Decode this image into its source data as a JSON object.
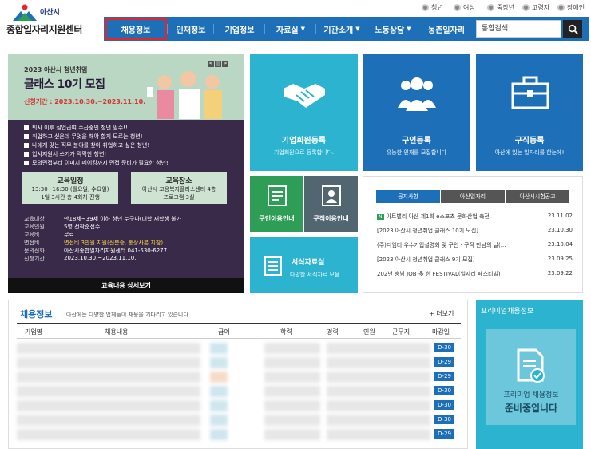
{
  "header": {
    "logo_small": "아산시",
    "logo_title": "종합일자리지원센터",
    "util_links": [
      "청년",
      "여성",
      "중장년",
      "고령자",
      "장애인"
    ]
  },
  "nav": {
    "items": [
      "채용정보",
      "인재정보",
      "기업정보",
      "자료실",
      "기관소개",
      "노동상담",
      "농촌일자리"
    ],
    "search_placeholder": "통합검색"
  },
  "banner": {
    "small": "2023 아산시 청년취업",
    "title": "클래스 10기 모집",
    "period": "신청기간 : 2023.10.30.~2023.11.10.",
    "bullets": [
      "퇴사 이후 실업급여 수급중인 청년 필수!!",
      "취업하고 싶은데 무엇을 해야 할지 모르는 청년!",
      "나에게 맞는 직무 분야를 찾아 취업하고 싶은 청년!",
      "입사지원서 쓰기가 막막한 청년!",
      "모의면접부터 이미지 메이킹까지 면접 준비가 필요한 청년!"
    ],
    "box1": {
      "head": "교육일정",
      "line1": "13:30~16:30 (월요일, 수요일)",
      "line2": "1일 3시간 총 4회차 진행"
    },
    "box2": {
      "head": "교육장소",
      "line1": "아산시 고용복지플러스센터 4층",
      "line2": "프로그램 3실"
    },
    "info": [
      {
        "k": "교육대상",
        "v": "만18세~39세 이하 청년 누구나(대학 재학생 불가"
      },
      {
        "k": "교육인원",
        "v": "5명 선착순접수"
      },
      {
        "k": "교육비",
        "v": "무료"
      },
      {
        "k": "면접비",
        "v": "면접비 3만원 지원(신분증, 통장사본 지참)"
      },
      {
        "k": "문의전화",
        "v": "아산시종합일자리지원센터 041-530-6277"
      },
      {
        "k": "신청기간",
        "v": "2023.10.30.~2023.11.10."
      }
    ],
    "detail_button": "교육내용 상세보기",
    "controls": [
      "<",
      "||",
      ">"
    ]
  },
  "tiles": {
    "member": {
      "title": "기업회원등록",
      "desc": "기업회원으로 등록합니다."
    },
    "talent": {
      "title": "구인등록",
      "desc": "유능한 인재를 모집합니다"
    },
    "jobseek": {
      "title": "구직등록",
      "desc": "아산에 있는 일자리를 한눈에!"
    },
    "guide_hire": {
      "title": "구인이용안내"
    },
    "guide_seek": {
      "title": "구직이용안내"
    },
    "library": {
      "title": "서식자료실",
      "desc": "다양한 서식자료 모음"
    }
  },
  "notice": {
    "tabs": [
      "공지사항",
      "아산일자리",
      "아산시시험공고"
    ],
    "rows": [
      {
        "title": "아트밸리 아산 제1회 e스포츠 문화산업 축전",
        "date": "23.11.02",
        "new": true
      },
      {
        "title": "[2023 아산시 청년취업 클래스 10기 모집]",
        "date": "23.10.30"
      },
      {
        "title": "(주)디엠티 우수기업설명회 및 구인 · 구직 만남의 날(...",
        "date": "23.10.04"
      },
      {
        "title": "[2023 아산시 청년취업 클래스 9기 모집]",
        "date": "23.09.25"
      },
      {
        "title": "202년 충남 JOB 多 한 FESTIVAL(일자리 페스티벌)",
        "date": "23.09.22"
      }
    ],
    "new_badge": "N"
  },
  "jobs": {
    "title": "채용정보",
    "desc": "아산에는 다양한 업체들이 채용을 기다리고 있습니다.",
    "more": "+ 더보기",
    "columns": [
      "기업명",
      "채용내용",
      "급여",
      "학력",
      "경력",
      "인원",
      "근무지",
      "마감일"
    ],
    "deadlines": [
      "D-30",
      "D-29",
      "D-29",
      "D-30",
      "D-30",
      "D-30",
      "D-29"
    ]
  },
  "premium": {
    "title": "프리미엄채용정보",
    "line1": "프리미엄 채용정보",
    "line2": "준비중입니다"
  },
  "colors": {
    "primary": "#1d6fb8",
    "cyan": "#2bb3cf",
    "green": "#2e9e57",
    "slate": "#516671",
    "highlight": "#e3262b"
  }
}
